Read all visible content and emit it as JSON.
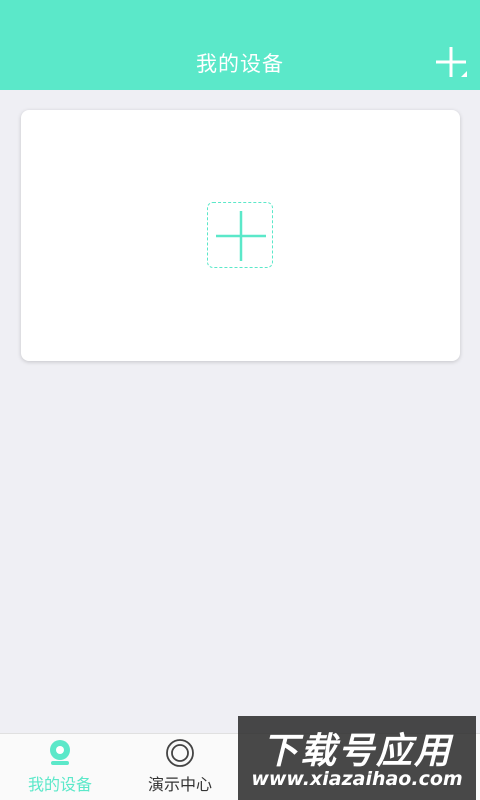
{
  "header": {
    "title": "我的设备",
    "add_icon": "plus-icon"
  },
  "card": {
    "add_icon": "plus-icon"
  },
  "tabs": [
    {
      "label": "我的设备",
      "icon": "camera-icon",
      "active": true
    },
    {
      "label": "演示中心",
      "icon": "target-icon",
      "active": false
    }
  ],
  "watermark": {
    "title": "下载号应用",
    "url": "www.xiazaihao.com"
  },
  "colors": {
    "accent": "#5be8c9",
    "background": "#efeff4"
  }
}
